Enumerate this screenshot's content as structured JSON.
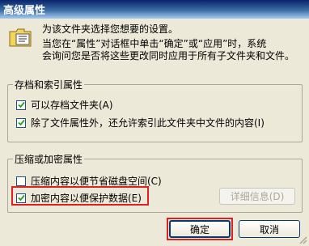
{
  "window": {
    "title": "高级属性"
  },
  "description": {
    "line1": "为该文件夹选择您想要的设置。",
    "line2": "当您在“属性”对话框中单击“确定”或“应用”时，系统",
    "line3": "会询问您是否将这些更改同时应用于所有子文件夹和文件。"
  },
  "archive_group": {
    "label": "存档和索引属性",
    "items": [
      {
        "label": "可以存档文件夹(A)",
        "checked": true
      },
      {
        "label": "除了文件属性外，还允许索引此文件夹中文件的内容(I)",
        "checked": true
      }
    ]
  },
  "compress_group": {
    "label": "压缩或加密属性",
    "items": [
      {
        "label": "压缩内容以便节省磁盘空间(C)",
        "checked": false
      },
      {
        "label": "加密内容以便保护数据(E)",
        "checked": true
      }
    ],
    "details_button": "详细信息(D)"
  },
  "buttons": {
    "ok": "确定",
    "cancel": "取消"
  },
  "icons": {
    "folder": "folder-properties-icon",
    "check": "checkmark-icon"
  },
  "colors": {
    "highlight": "#e02020",
    "title_bar_start": "#0a246a",
    "title_bar_end": "#a6caf0"
  }
}
